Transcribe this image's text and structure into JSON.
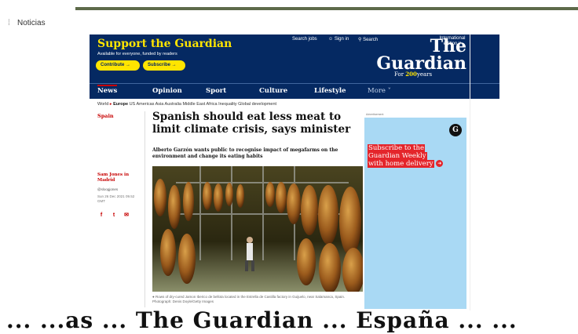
{
  "page": {
    "section_label": "Noticias"
  },
  "header": {
    "support_title": "Support the Guardian",
    "support_subtitle": "Available for everyone, funded by readers",
    "contribute_label": "Contribute →",
    "subscribe_label": "Subscribe →",
    "search_jobs": "Search jobs",
    "sign_in": "Sign in",
    "search": "Search",
    "edition": "International edition",
    "logo_line1": "The",
    "logo_line2": "Guardian",
    "for_label": "For",
    "years_number": "200",
    "years_label": "years"
  },
  "nav": {
    "items": [
      {
        "label": "News"
      },
      {
        "label": "Opinion"
      },
      {
        "label": "Sport"
      },
      {
        "label": "Culture"
      },
      {
        "label": "Lifestyle"
      },
      {
        "label": "More"
      }
    ]
  },
  "subnav": {
    "items": [
      "World",
      "Europe",
      "US",
      "Americas",
      "Asia",
      "Australia",
      "Middle East",
      "Africa",
      "Inequality",
      "Global development"
    ],
    "active": "Europe"
  },
  "article": {
    "section": "Spain",
    "headline": "Spanish should eat less meat to limit climate crisis, says minister",
    "standfirst": "Alberto Garzón wants public to recognise impact of megafarms on the environment and change its eating habits",
    "author": "Sam Jones in Madrid",
    "handle": "@sloogjones",
    "date": "Sun 26 Dec 2021 09.52 GMT",
    "caption": "Rows of dry-cured Jamon Iberico de bellota located in the Estrella de Castilla factory in Guijuelo, near Salamanca, Spain. Photograph: Denis Doyle/Getty Images"
  },
  "share": {
    "icons": [
      "facebook-icon",
      "twitter-icon",
      "email-icon"
    ],
    "labels": [
      "f",
      "t",
      "✉"
    ]
  },
  "ad": {
    "label": "Advertisement",
    "logo_letter": "G",
    "line1": "Subscribe to the",
    "line2": "Guardian Weekly",
    "line3": "with home delivery"
  },
  "bottom_banner": {
    "text": "... ...as ... The Guardian ... España ... ..."
  },
  "colors": {
    "guardian_blue": "#052962",
    "guardian_yellow": "#ffe500",
    "news_red": "#c70000",
    "ad_blue": "#a9d9f4",
    "ad_red": "#e4252b"
  }
}
